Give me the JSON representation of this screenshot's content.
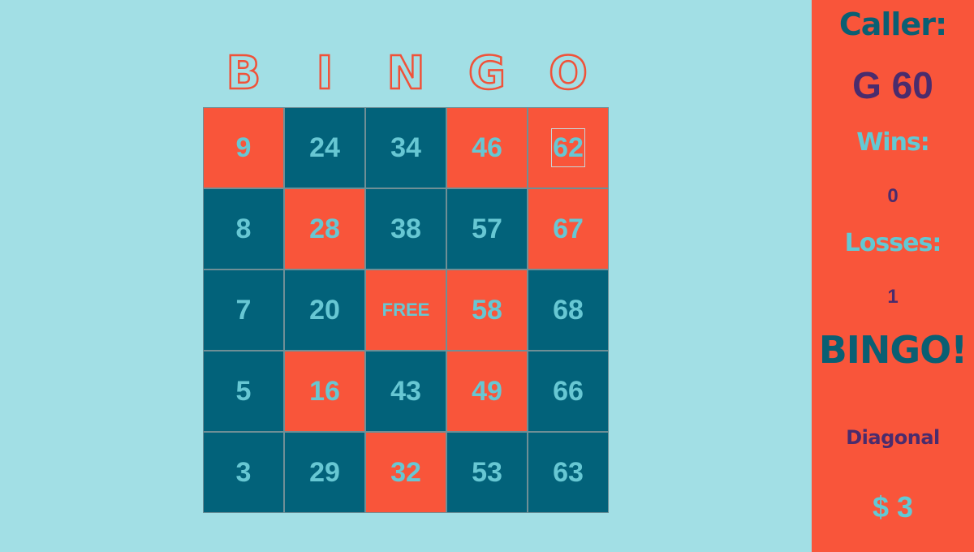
{
  "header": {
    "letters": [
      "B",
      "I",
      "N",
      "G",
      "O"
    ]
  },
  "card": {
    "rows": [
      [
        {
          "value": "9",
          "color": "orange"
        },
        {
          "value": "24",
          "color": "teal"
        },
        {
          "value": "34",
          "color": "teal"
        },
        {
          "value": "46",
          "color": "orange"
        },
        {
          "value": "62",
          "color": "orange",
          "focused": true
        }
      ],
      [
        {
          "value": "8",
          "color": "teal"
        },
        {
          "value": "28",
          "color": "orange"
        },
        {
          "value": "38",
          "color": "teal"
        },
        {
          "value": "57",
          "color": "teal"
        },
        {
          "value": "67",
          "color": "orange"
        }
      ],
      [
        {
          "value": "7",
          "color": "teal"
        },
        {
          "value": "20",
          "color": "teal"
        },
        {
          "value": "FREE",
          "color": "orange",
          "free": true
        },
        {
          "value": "58",
          "color": "orange"
        },
        {
          "value": "68",
          "color": "teal"
        }
      ],
      [
        {
          "value": "5",
          "color": "teal"
        },
        {
          "value": "16",
          "color": "orange"
        },
        {
          "value": "43",
          "color": "teal"
        },
        {
          "value": "49",
          "color": "orange"
        },
        {
          "value": "66",
          "color": "teal"
        }
      ],
      [
        {
          "value": "3",
          "color": "teal"
        },
        {
          "value": "29",
          "color": "teal"
        },
        {
          "value": "32",
          "color": "orange"
        },
        {
          "value": "53",
          "color": "teal"
        },
        {
          "value": "63",
          "color": "teal"
        }
      ]
    ]
  },
  "panel": {
    "caller_label": "Caller:",
    "caller_value": "G 60",
    "wins_label": "Wins:",
    "wins_value": "0",
    "losses_label": "Losses:",
    "losses_value": "1",
    "bingo_label": "BINGO!",
    "pattern": "Diagonal",
    "prize": "$ 3"
  },
  "colors": {
    "background": "#a2dfe5",
    "orange": "#f9553a",
    "teal": "#02627a",
    "cell_text": "#67c7d3",
    "purple": "#4a2c6d"
  }
}
